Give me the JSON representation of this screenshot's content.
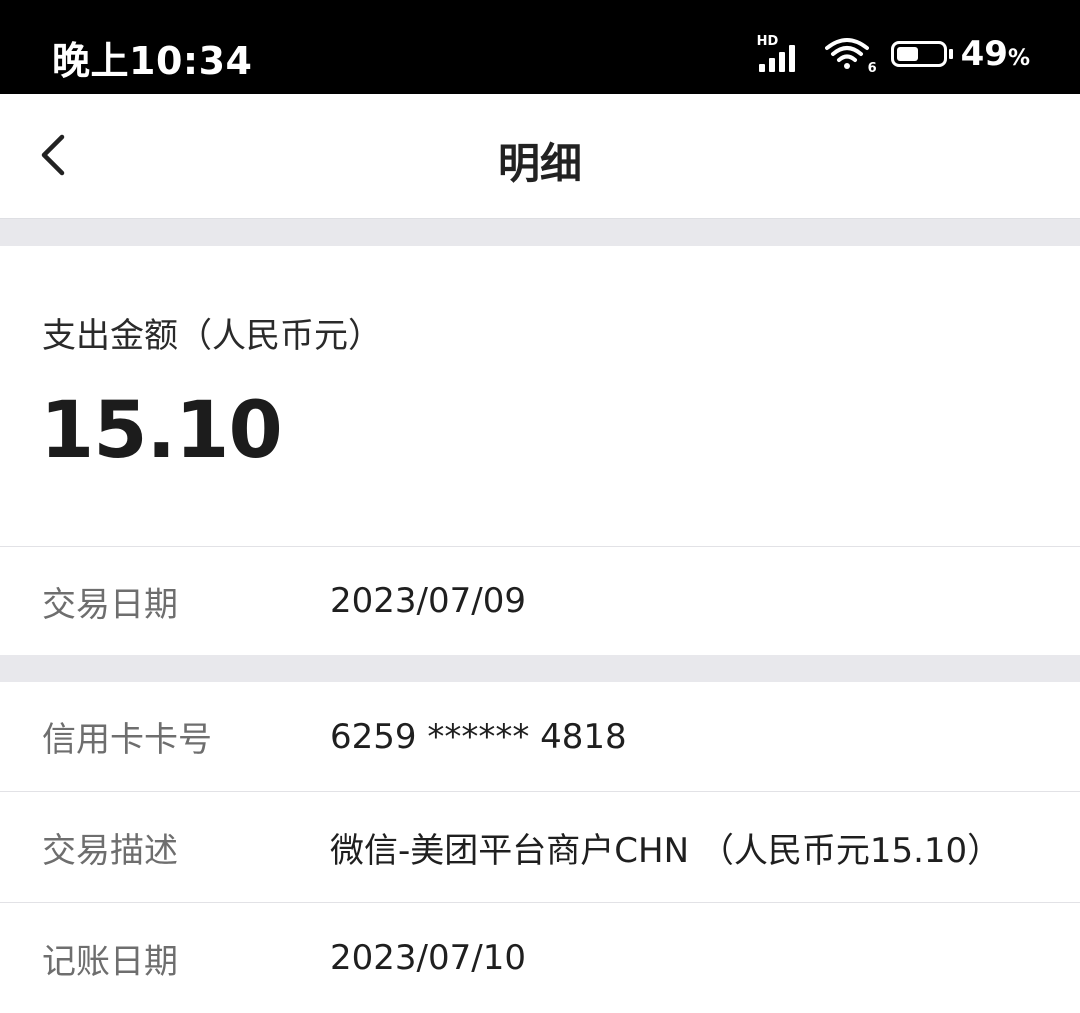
{
  "status_bar": {
    "time": "晚上10:34",
    "network_badge": "HD",
    "wifi_badge": "6",
    "battery_level": 0.49,
    "battery_percent": "49",
    "battery_percent_sign": "%"
  },
  "nav": {
    "back_icon": "chevron-left-icon",
    "title": "明细"
  },
  "summary": {
    "amount_label": "支出金额（人民币元）",
    "amount_value": "15.10"
  },
  "details": {
    "transaction_date": {
      "label": "交易日期",
      "value": "2023/07/09"
    },
    "card_number": {
      "label": "信用卡卡号",
      "value": "6259 ****** 4818"
    },
    "description": {
      "label": "交易描述",
      "value": "微信-美团平台商户CHN （人民币元15.10）"
    },
    "posting_date": {
      "label": "记账日期",
      "value": "2023/07/10"
    }
  },
  "colors": {
    "status_bar_bg": "#000000",
    "section_gap": "#e8e8ec",
    "label_text": "#6e6e6e",
    "value_text": "#1f1f1f"
  }
}
